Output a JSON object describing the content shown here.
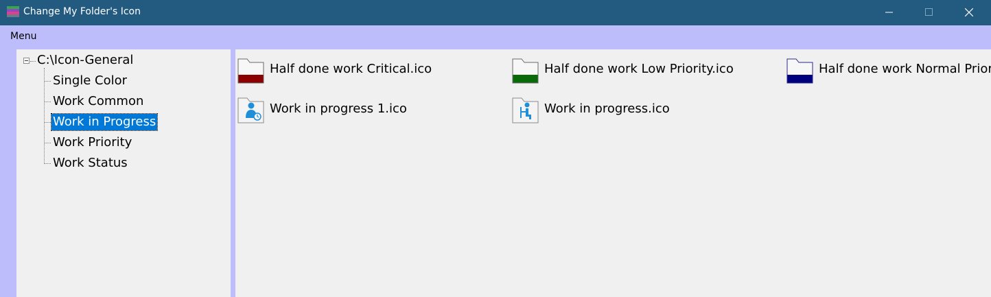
{
  "window": {
    "title": "Change My Folder's Icon",
    "controls": [
      "minimize",
      "maximize",
      "close"
    ]
  },
  "menu": {
    "items": [
      "Menu"
    ]
  },
  "tree": {
    "root": "C:\\Icon-General",
    "root_expanded": true,
    "children": [
      "Single Color",
      "Work Common",
      "Work in Progress",
      "Work Priority",
      "Work Status"
    ],
    "selected": "Work in Progress"
  },
  "files": [
    {
      "name": "Half done work Critical.ico",
      "icon": "folder-half-red-icon",
      "color": "#8b0000"
    },
    {
      "name": "Half done work Low Priority.ico",
      "icon": "folder-half-green-icon",
      "color": "#0a6a0a"
    },
    {
      "name": "Half done work Normal Prior",
      "icon": "folder-half-blue-icon",
      "color": "#00007f"
    },
    {
      "name": "Work in progress 1.ico",
      "icon": "work-in-progress-person-icon",
      "color": "#1f8fd8"
    },
    {
      "name": "Work in progress.ico",
      "icon": "work-in-progress-desk-icon",
      "color": "#1f8fd8"
    }
  ],
  "colors": {
    "titlebar": "#225a80",
    "background": "#bdbdfb",
    "panel": "#f0f0f0",
    "selection": "#0078d7"
  }
}
